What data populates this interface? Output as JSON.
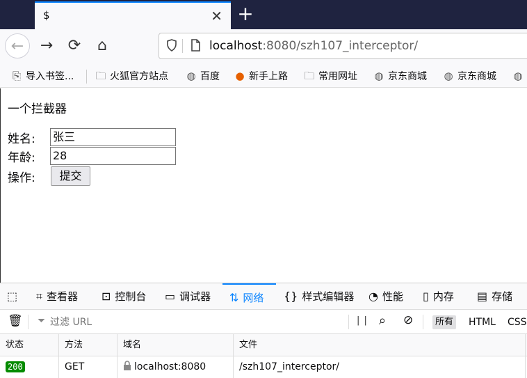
{
  "tab": {
    "title": "$",
    "close": "✕",
    "new": "+"
  },
  "nav": {
    "back": "←",
    "forward": "→",
    "reload": "⟳",
    "home": "⌂"
  },
  "urlbar": {
    "host": "localhost",
    "rest": ":8080/szh107_interceptor/"
  },
  "bookmarks": [
    {
      "label": "导入书签...",
      "icon": "import-icon"
    },
    {
      "label": "火狐官方站点",
      "icon": "folder-icon"
    },
    {
      "label": "百度",
      "icon": "globe-icon"
    },
    {
      "label": "新手上路",
      "icon": "firefox-icon"
    },
    {
      "label": "常用网址",
      "icon": "folder-icon"
    },
    {
      "label": "京东商城",
      "icon": "globe-icon"
    },
    {
      "label": "京东商城",
      "icon": "globe-icon"
    }
  ],
  "page": {
    "heading": "一个拦截器",
    "name_label": "姓名:",
    "name_value": "张三",
    "age_label": "年龄:",
    "age_value": "28",
    "action_label": "操作:",
    "submit_label": "提交"
  },
  "devtools": {
    "tabs": [
      {
        "label": "",
        "icon": "pick-element-icon"
      },
      {
        "label": "查看器",
        "icon": "inspector-icon"
      },
      {
        "label": "控制台",
        "icon": "console-icon"
      },
      {
        "label": "调试器",
        "icon": "debugger-icon"
      },
      {
        "label": "网络",
        "icon": "network-icon"
      },
      {
        "label": "样式编辑器",
        "icon": "style-editor-icon"
      },
      {
        "label": "性能",
        "icon": "performance-icon"
      },
      {
        "label": "内存",
        "icon": "memory-icon"
      },
      {
        "label": "存储",
        "icon": "storage-icon"
      }
    ],
    "filter_placeholder": "过滤 URL",
    "pause": "| |",
    "filter_types": [
      "所有",
      "HTML",
      "CSS"
    ],
    "columns": [
      "状态",
      "方法",
      "域名",
      "文件"
    ],
    "rows": [
      {
        "status": "200",
        "method": "GET",
        "domain": "localhost:8080",
        "file": "/szh107_interceptor/"
      }
    ],
    "accent": "#0a84ff"
  }
}
